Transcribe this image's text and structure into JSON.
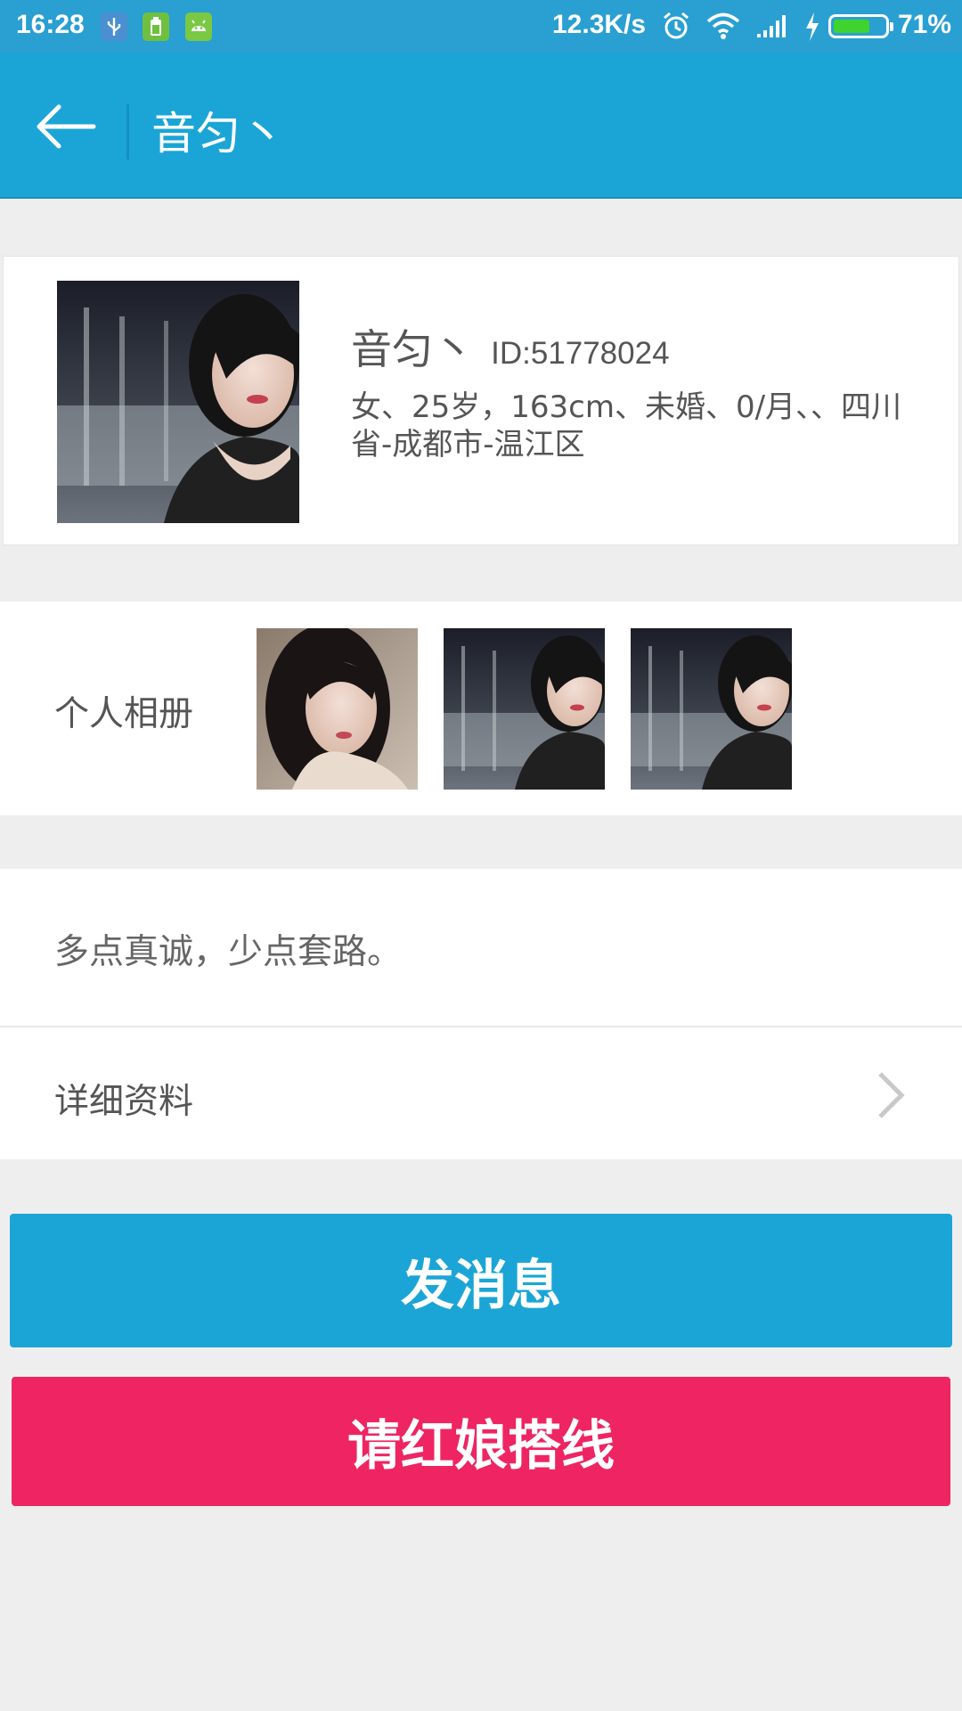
{
  "status_bar": {
    "time": "16:28",
    "network_speed": "12.3K/s",
    "battery_level": 0.71,
    "battery_text": "71%",
    "icons": [
      "usb-icon",
      "battery-saver-icon",
      "android-icon",
      "alarm-icon",
      "wifi-icon",
      "signal-icon",
      "charging-icon",
      "battery-icon"
    ]
  },
  "header": {
    "title": "音匀丶",
    "back_icon": "back-arrow-icon"
  },
  "profile": {
    "name": "音匀丶",
    "id_text": "ID:51778024",
    "info": "女、25岁，163cm、未婚、0/月、、四川省-成都市-温江区"
  },
  "album": {
    "label": "个人相册",
    "photos": [
      "photo-1",
      "photo-2",
      "photo-3"
    ]
  },
  "motto": "多点真诚，少点套路。",
  "details": {
    "label": "详细资料",
    "icon": "chevron-right-icon"
  },
  "buttons": {
    "send_message": "发消息",
    "matchmaker": "请红娘搭线"
  },
  "colors": {
    "header": "#1ba5d6",
    "status_bar": "#2a9fd2",
    "primary_button": "#1ba5d6",
    "secondary_button": "#ee2562",
    "background": "#eeeeee"
  }
}
